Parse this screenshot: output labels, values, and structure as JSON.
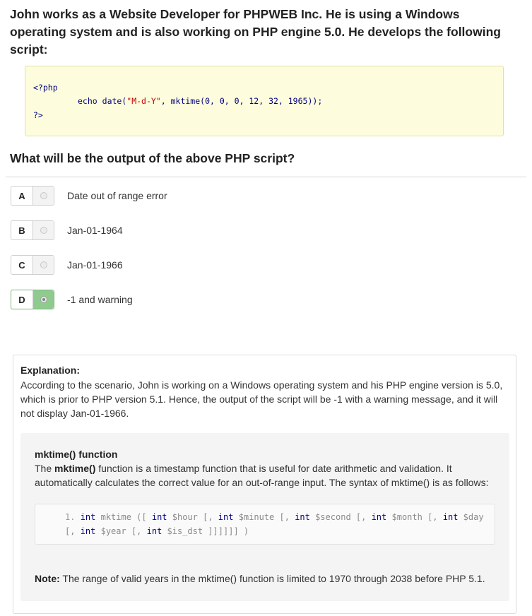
{
  "question": {
    "text": "John works as a Website Developer for PHPWEB Inc. He is using a Windows operating system and is also working on PHP engine 5.0. He develops the following script:"
  },
  "code": {
    "open_tag": "<?php",
    "echo_kw": "echo",
    "fn_name": "date(",
    "format_str": "\"M-d-Y\"",
    "sep1": ", ",
    "inner_fn": "mktime(",
    "args": "0, 0, 0, 12, 32, 1965",
    "close": "));",
    "close_tag": "?>"
  },
  "prompt": "What will be the output of the above PHP script?",
  "options": [
    {
      "letter": "A",
      "text": "Date out of range error",
      "selected": false
    },
    {
      "letter": "B",
      "text": "Jan-01-1964",
      "selected": false
    },
    {
      "letter": "C",
      "text": "Jan-01-1966",
      "selected": false
    },
    {
      "letter": "D",
      "text": "-1 and warning",
      "selected": true
    }
  ],
  "explanation": {
    "title": "Explanation:",
    "text": "According to the scenario, John is working on a Windows operating system and his PHP engine version is 5.0, which is prior to PHP version 5.1. Hence, the output of the script will be -1 with a warning message, and it will not display Jan-01-1966.",
    "section_title": "mktime() function",
    "section_text_prefix": "The ",
    "section_text_bold": "mktime()",
    "section_text_rest": " function is a timestamp function that is useful for date arithmetic and validation. It automatically calculates the correct value for an out-of-range input. The syntax of mktime() is as follows:",
    "syntax_line_no": "1.",
    "syntax_line1": {
      "p1": "int",
      "p2": " mktime ([ ",
      "p3": "int",
      "p4": " $hour [, ",
      "p5": "int",
      "p6": " $minute [, ",
      "p7": "int",
      "p8": " $second [, ",
      "p9": "int",
      "p10": " $month [, ",
      "p11": "int",
      "p12": " $day"
    },
    "syntax_line2": {
      "p1": "[, ",
      "p2": "int",
      "p3": " $year [, ",
      "p4": "int",
      "p5": " $is_dst ]]]]]] )"
    },
    "note_label": "Note:",
    "note_text": " The range of valid years in the mktime() function is limited to 1970 through 2038 before PHP 5.1."
  },
  "colors": {
    "code_bg": "#fdfcdc",
    "selected_green": "#8fcb8f",
    "panel_bg": "#f4f4f4"
  }
}
